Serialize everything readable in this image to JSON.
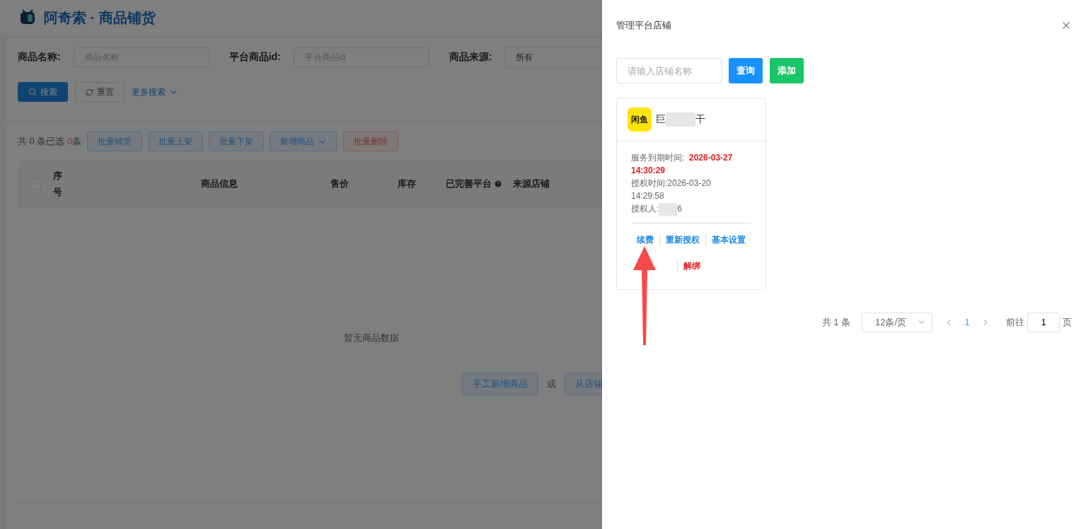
{
  "app": {
    "title": "阿奇索 · 商品铺货"
  },
  "filters": [
    {
      "label": "商品名称:",
      "placeholder": "商品名称",
      "kind": "input"
    },
    {
      "label": "平台商品id:",
      "placeholder": "平台商品id",
      "kind": "input"
    },
    {
      "label": "商品来源:",
      "value": "所有",
      "kind": "select"
    }
  ],
  "filter_actions": {
    "search": "搜索",
    "reset": "重置",
    "more": "更多搜索"
  },
  "summary": {
    "prefix": "共 0 条已选 ",
    "selected_count": "0",
    "suffix": "条"
  },
  "batch_buttons": [
    {
      "label": "批量铺货",
      "kind": "plain"
    },
    {
      "label": "批量上架",
      "kind": "plain"
    },
    {
      "label": "批量下架",
      "kind": "plain"
    },
    {
      "label": "新增商品",
      "kind": "dropdown"
    },
    {
      "label": "批量删除",
      "kind": "danger"
    }
  ],
  "table": {
    "checked": false,
    "columns": [
      {
        "label": "序号",
        "help": false
      },
      {
        "label": "商品信息",
        "help": false
      },
      {
        "label": "售价",
        "help": false
      },
      {
        "label": "库存",
        "help": false
      },
      {
        "label": "已完善平台",
        "help": true
      },
      {
        "label": "来源店铺",
        "help": false
      }
    ],
    "empty_text": "暂无商品数据",
    "empty_actions": [
      "手工新增商品",
      "或",
      "从店铺"
    ]
  },
  "drawer": {
    "title": "管理平台店铺",
    "search_placeholder": "请输入店铺名称",
    "query": "查询",
    "add": "添加",
    "shops": [
      {
        "logo": "闲鱼",
        "name_start": "巨",
        "name_end": "干",
        "expire_label": "服务到期时间:",
        "expire_value": "2026-03-27 14:30:29",
        "auth_label": "授权时间:",
        "auth_value": "2026-03-20 14:29:58",
        "owner_label": "授权人:",
        "owner_end": "6",
        "actions": [
          {
            "label": "续费",
            "kind": "link"
          },
          {
            "label": "重新授权",
            "kind": "link"
          },
          {
            "label": "基本设置",
            "kind": "link"
          },
          {
            "label": "解绑",
            "kind": "danger"
          }
        ]
      }
    ],
    "pagination": {
      "total": "共 1 条",
      "page_size": "12条/页",
      "pages": [
        {
          "label": "1",
          "selected": true
        }
      ],
      "goto_label": "前往",
      "goto_value": "1",
      "goto_suffix": "页"
    }
  }
}
